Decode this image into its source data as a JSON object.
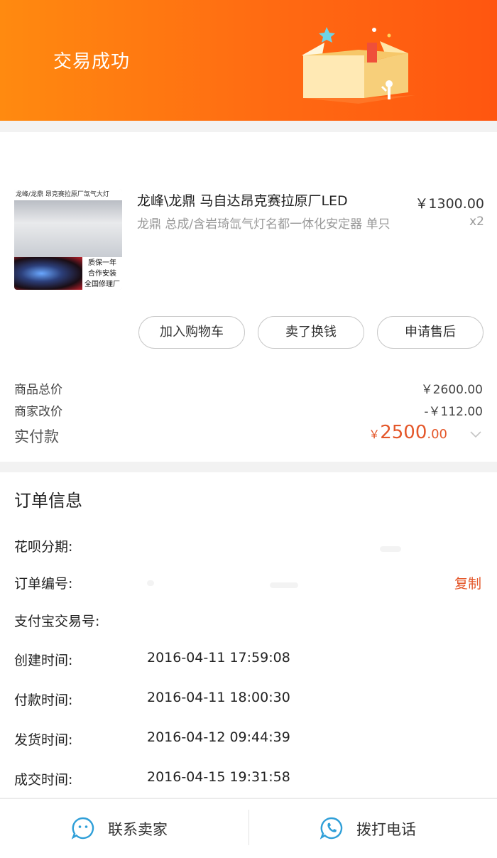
{
  "header": {
    "title": "交易成功"
  },
  "product": {
    "thumb_top_text": "龙峰/龙鼎 昂克赛拉原厂氙气大灯",
    "thumb_badge": [
      "质保一年",
      "合作安装",
      "全国修理厂"
    ],
    "title": "龙峰\\龙鼎 马自达昂克赛拉原厂LED",
    "spec": "龙鼎 总成/含岩琦氙气灯名都一体化安定器 单只",
    "price": "￥1300.00",
    "qty": "x2"
  },
  "actions": {
    "add_cart": "加入购物车",
    "sell": "卖了换钱",
    "after_sale": "申请售后"
  },
  "summary": {
    "goods_total_label": "商品总价",
    "goods_total_value": "￥2600.00",
    "discount_label": "商家改价",
    "discount_value": "-￥112.00",
    "paid_label": "实付款",
    "paid_currency": "￥",
    "paid_int": "2500",
    "paid_dec": ".00"
  },
  "order": {
    "title": "订单信息",
    "installment_label": "花呗分期:",
    "order_no_label": "订单编号:",
    "copy_label": "复制",
    "alipay_no_label": "支付宝交易号:",
    "rows": [
      {
        "label": "创建时间:",
        "value": "2016-04-11 17:59:08"
      },
      {
        "label": "付款时间:",
        "value": "2016-04-11 18:00:30"
      },
      {
        "label": "发货时间:",
        "value": "2016-04-12 09:44:39"
      },
      {
        "label": "成交时间:",
        "value": "2016-04-15 19:31:58"
      }
    ]
  },
  "footer": {
    "contact_seller": "联系卖家",
    "call_phone": "拨打电话"
  },
  "colors": {
    "brand_orange": "#ff6a12",
    "accent_red": "#e4572a",
    "icon_blue": "#2f9fd8"
  }
}
